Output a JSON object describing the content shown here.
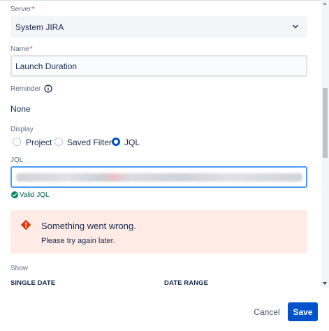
{
  "form": {
    "server": {
      "label": "Server",
      "required_mark": "*",
      "value": "System JIRA",
      "chevron_icon": "chevron-down-icon"
    },
    "name": {
      "label": "Name",
      "required_mark": "*",
      "value": "Launch Duration"
    },
    "reminder": {
      "label": "Reminder",
      "info_icon": "info-icon",
      "value": "None"
    },
    "display": {
      "label": "Display",
      "options": [
        {
          "label": "Project",
          "checked": false
        },
        {
          "label": "Saved Filter",
          "checked": false
        },
        {
          "label": "JQL",
          "checked": true
        }
      ]
    },
    "jql": {
      "label": "JQL",
      "validation": "Valid JQL"
    },
    "error": {
      "icon": "warning-icon",
      "title": "Something went wrong.",
      "message": "Please try again later."
    },
    "show": {
      "label": "Show",
      "columns": [
        "SINGLE DATE",
        "DATE RANGE"
      ]
    }
  },
  "footer": {
    "cancel_label": "Cancel",
    "save_label": "Save"
  },
  "colors": {
    "primary": "#0052cc",
    "error_bg": "#ffebe6",
    "error_icon": "#de350b",
    "valid": "#00875a",
    "focus": "#4c9aff"
  }
}
